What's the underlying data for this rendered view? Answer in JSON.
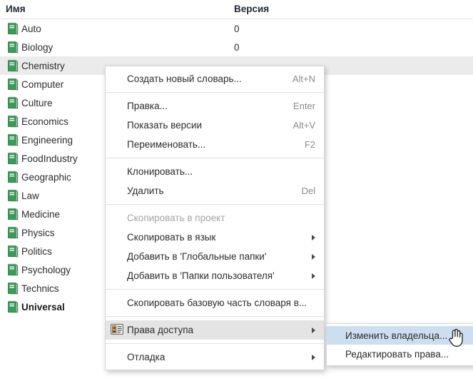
{
  "table": {
    "columns": [
      "Имя",
      "Версия"
    ],
    "rows": [
      {
        "icon": "book-icon",
        "name": "Auto",
        "version": "0",
        "selected": false,
        "bold": false
      },
      {
        "icon": "book-icon",
        "name": "Biology",
        "version": "0",
        "selected": false,
        "bold": false
      },
      {
        "icon": "book-icon",
        "name": "Chemistry",
        "version": "",
        "selected": true,
        "bold": false
      },
      {
        "icon": "book-icon",
        "name": "Computer",
        "version": "",
        "selected": false,
        "bold": false
      },
      {
        "icon": "book-icon",
        "name": "Culture",
        "version": "",
        "selected": false,
        "bold": false
      },
      {
        "icon": "book-icon",
        "name": "Economics",
        "version": "",
        "selected": false,
        "bold": false
      },
      {
        "icon": "book-icon",
        "name": "Engineering",
        "version": "",
        "selected": false,
        "bold": false
      },
      {
        "icon": "book-icon",
        "name": "FoodIndustry",
        "version": "",
        "selected": false,
        "bold": false
      },
      {
        "icon": "book-icon",
        "name": "Geographic",
        "version": "",
        "selected": false,
        "bold": false
      },
      {
        "icon": "book-icon",
        "name": "Law",
        "version": "",
        "selected": false,
        "bold": false
      },
      {
        "icon": "book-icon",
        "name": "Medicine",
        "version": "",
        "selected": false,
        "bold": false
      },
      {
        "icon": "book-icon",
        "name": "Physics",
        "version": "",
        "selected": false,
        "bold": false
      },
      {
        "icon": "book-icon",
        "name": "Politics",
        "version": "",
        "selected": false,
        "bold": false
      },
      {
        "icon": "book-icon",
        "name": "Psychology",
        "version": "",
        "selected": false,
        "bold": false
      },
      {
        "icon": "book-icon",
        "name": "Technics",
        "version": "",
        "selected": false,
        "bold": false
      },
      {
        "icon": "book-icon",
        "name": "Universal",
        "version": "",
        "selected": false,
        "bold": true
      }
    ]
  },
  "context_menu": {
    "items": [
      {
        "type": "item",
        "label": "Создать новый словарь...",
        "accel": "Alt+N",
        "submenu": false,
        "disabled": false,
        "highlighted": false,
        "icon": null
      },
      {
        "type": "separator"
      },
      {
        "type": "item",
        "label": "Правка...",
        "accel": "Enter",
        "submenu": false,
        "disabled": false,
        "highlighted": false,
        "icon": null
      },
      {
        "type": "item",
        "label": "Показать версии",
        "accel": "Alt+V",
        "submenu": false,
        "disabled": false,
        "highlighted": false,
        "icon": null
      },
      {
        "type": "item",
        "label": "Переименовать...",
        "accel": "F2",
        "submenu": false,
        "disabled": false,
        "highlighted": false,
        "icon": null
      },
      {
        "type": "separator"
      },
      {
        "type": "item",
        "label": "Клонировать...",
        "accel": "",
        "submenu": false,
        "disabled": false,
        "highlighted": false,
        "icon": null
      },
      {
        "type": "item",
        "label": "Удалить",
        "accel": "Del",
        "submenu": false,
        "disabled": false,
        "highlighted": false,
        "icon": null
      },
      {
        "type": "separator"
      },
      {
        "type": "item",
        "label": "Скопировать в проект",
        "accel": "",
        "submenu": false,
        "disabled": true,
        "highlighted": false,
        "icon": null
      },
      {
        "type": "item",
        "label": "Скопировать в язык",
        "accel": "",
        "submenu": true,
        "disabled": false,
        "highlighted": false,
        "icon": null
      },
      {
        "type": "item",
        "label": "Добавить в 'Глобальные папки'",
        "accel": "",
        "submenu": true,
        "disabled": false,
        "highlighted": false,
        "icon": null
      },
      {
        "type": "item",
        "label": "Добавить в 'Папки пользователя'",
        "accel": "",
        "submenu": true,
        "disabled": false,
        "highlighted": false,
        "icon": null
      },
      {
        "type": "separator"
      },
      {
        "type": "item",
        "label": "Скопировать базовую часть словаря в...",
        "accel": "",
        "submenu": false,
        "disabled": false,
        "highlighted": false,
        "icon": null
      },
      {
        "type": "separator"
      },
      {
        "type": "item",
        "label": "Права доступа",
        "accel": "",
        "submenu": true,
        "disabled": false,
        "highlighted": true,
        "icon": "id-card-icon"
      },
      {
        "type": "separator"
      },
      {
        "type": "item",
        "label": "Отладка",
        "accel": "",
        "submenu": true,
        "disabled": false,
        "highlighted": false,
        "icon": null
      }
    ]
  },
  "sub_menu": {
    "items": [
      {
        "type": "item",
        "label": "Изменить владельца...",
        "accel": "",
        "submenu": false,
        "disabled": false,
        "highlighted": true
      },
      {
        "type": "item",
        "label": "Редактировать права...",
        "accel": "",
        "submenu": false,
        "disabled": false,
        "highlighted": false
      }
    ]
  },
  "cursor": {
    "icon": "hand-pointer-cursor"
  },
  "colors": {
    "row_selected": "#ebebeb",
    "menu_highlight": "#e4e4e4",
    "submenu_highlight": "#cddef0",
    "book_icon_green": "#3d9a5b",
    "accel_text": "#8a8a8a",
    "disabled_text": "#a4a4a4"
  }
}
